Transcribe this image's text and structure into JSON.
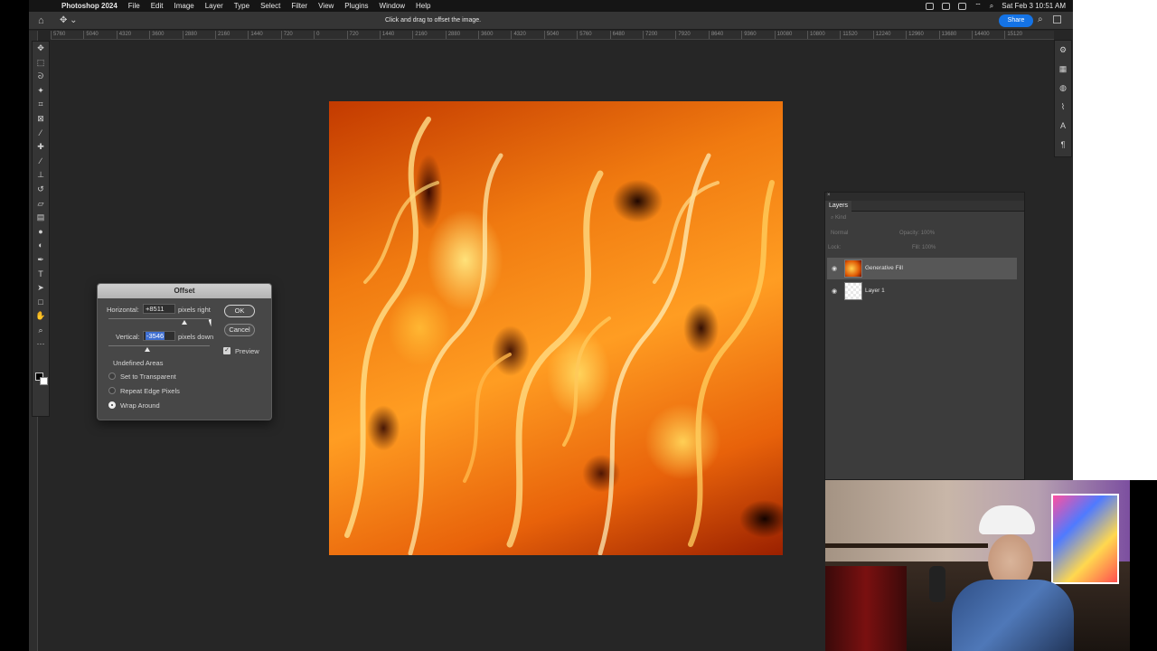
{
  "menubar": {
    "app_name": "Photoshop 2024",
    "items": [
      "File",
      "Edit",
      "Image",
      "Layer",
      "Type",
      "Select",
      "Filter",
      "View",
      "Plugins",
      "Window",
      "Help"
    ],
    "clock": "Sat Feb 3  10:51 AM"
  },
  "options_bar": {
    "hint": "Click and drag to offset the image.",
    "share_label": "Share"
  },
  "ruler": {
    "ticks": [
      "5760",
      "5040",
      "4320",
      "3600",
      "2880",
      "2160",
      "1440",
      "720",
      "0",
      "720",
      "1440",
      "2160",
      "2880",
      "3600",
      "4320",
      "5040",
      "5760",
      "6480",
      "7200",
      "7920",
      "8640",
      "9360",
      "10080",
      "10800",
      "11520",
      "12240",
      "12960",
      "13680",
      "14400",
      "15120"
    ]
  },
  "tools": [
    "move-tool",
    "marquee-tool",
    "lasso-tool",
    "magic-wand-tool",
    "crop-tool",
    "frame-tool",
    "eyedropper-tool",
    "healing-brush-tool",
    "brush-tool",
    "clone-stamp-tool",
    "history-brush-tool",
    "eraser-tool",
    "gradient-tool",
    "blur-tool",
    "dodge-tool",
    "pen-tool",
    "type-tool",
    "path-selection-tool",
    "rectangle-tool",
    "hand-tool",
    "zoom-tool",
    "more-tools"
  ],
  "offset_dialog": {
    "title": "Offset",
    "horizontal_label": "Horizontal:",
    "horizontal_value": "+8511",
    "horizontal_unit": "pixels right",
    "vertical_label": "Vertical:",
    "vertical_value": "-3546",
    "vertical_unit": "pixels down",
    "ok_label": "OK",
    "cancel_label": "Cancel",
    "preview_label": "Preview",
    "preview_checked": true,
    "undefined_areas_label": "Undefined Areas",
    "options": [
      {
        "label": "Set to Transparent",
        "selected": false
      },
      {
        "label": "Repeat Edge Pixels",
        "selected": false
      },
      {
        "label": "Wrap Around",
        "selected": true
      }
    ]
  },
  "layers_panel": {
    "tab_label": "Layers",
    "filter_placeholder": "Kind",
    "blend_mode": "Normal",
    "opacity_label": "Opacity:",
    "opacity_value": "100%",
    "lock_label": "Lock:",
    "fill_label": "Fill:",
    "fill_value": "100%",
    "layers": [
      {
        "name": "Generative Fill",
        "selected": true,
        "thumb": "fire"
      },
      {
        "name": "Layer 1",
        "selected": false,
        "thumb": "transparent"
      }
    ]
  },
  "colors": {
    "accent": "#1473e6",
    "panel_bg": "#3c3c3c",
    "app_bg": "#262626"
  }
}
